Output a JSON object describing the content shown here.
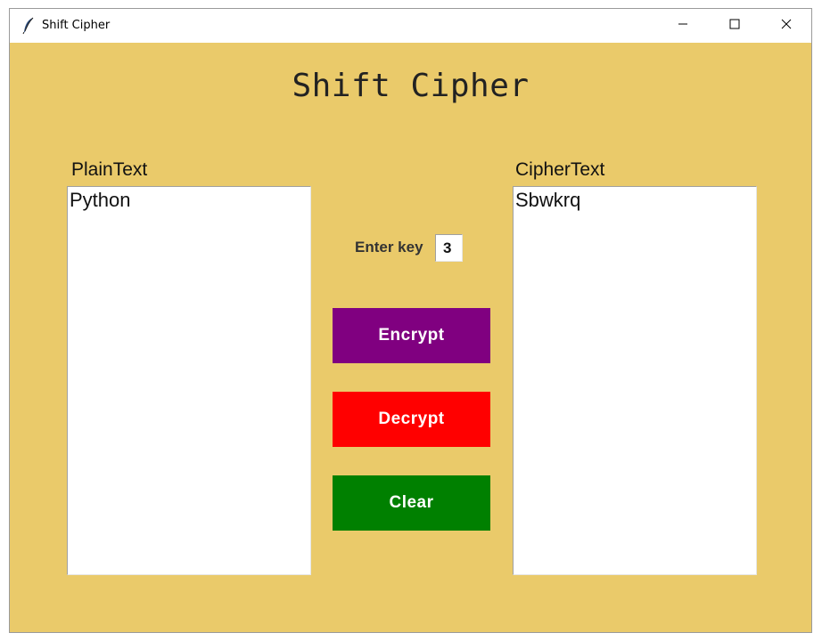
{
  "window": {
    "title": "Shift Cipher",
    "icon": "feather-icon",
    "controls": [
      "minimize-icon",
      "maximize-icon",
      "close-icon"
    ]
  },
  "main": {
    "heading": "Shift Cipher",
    "plaintext": {
      "label": "PlainText",
      "value": "Python"
    },
    "ciphertext": {
      "label": "CipherText",
      "value": "Sbwkrq"
    },
    "key": {
      "label": "Enter key",
      "value": "3"
    },
    "buttons": {
      "encrypt": "Encrypt",
      "decrypt": "Decrypt",
      "clear": "Clear"
    }
  },
  "colors": {
    "background": "#eaca6a",
    "encrypt": "#800080",
    "decrypt": "#ff0000",
    "clear": "#008000"
  }
}
